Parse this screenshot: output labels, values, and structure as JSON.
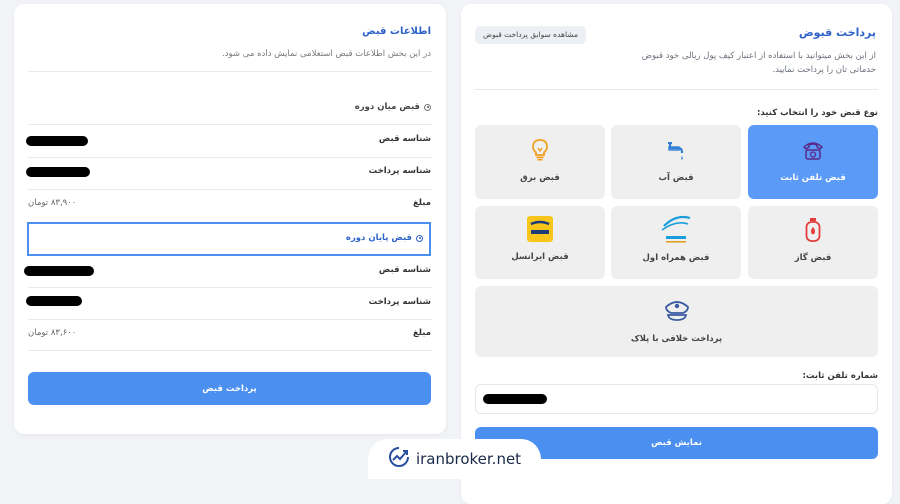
{
  "payment": {
    "title": "پرداخت قبوض",
    "history_button": "مشاهده سوابق پرداخت قبوض",
    "description": "از این بخش میتوانید با استفاده از اعتبار کیف پول ریالی خود قبوض خدماتی تان را پرداخت نمایید.",
    "type_label": "نوع قبض خود را انتخاب کنید:",
    "bill_types": [
      {
        "label": "قبض تلفن ثابت",
        "icon": "landline-phone-icon",
        "active": true
      },
      {
        "label": "قبض آب",
        "icon": "water-tap-icon",
        "active": false
      },
      {
        "label": "قبض برق",
        "icon": "light-bulb-icon",
        "active": false
      },
      {
        "label": "قبض گاز",
        "icon": "gas-cylinder-icon",
        "active": false
      },
      {
        "label": "قبض همراه اول",
        "icon": "hamrah-aval-logo",
        "active": false
      },
      {
        "label": "قبض ایرانسل",
        "icon": "irancell-logo",
        "active": false
      },
      {
        "label": "پرداخت خلافی با پلاک",
        "icon": "police-hat-icon",
        "active": false
      }
    ],
    "phone_label": "شماره تلفن ثابت:",
    "show_button": "نمایش قبض"
  },
  "bill_info": {
    "title": "اطلاعات قبض",
    "description": "در این بخش اطلاعات قبض استعلامی نمایش داده می شود.",
    "periods": [
      {
        "heading": "قبض میان دوره",
        "bill_id_label": "شناسه قبض",
        "payment_id_label": "شناسه پرداخت",
        "amount_label": "مبلغ",
        "amount_value": "۸۳,۹۰۰ تومان",
        "selected": false
      },
      {
        "heading": "قبض پایان دوره",
        "bill_id_label": "شناسه قبض",
        "payment_id_label": "شناسه پرداخت",
        "amount_label": "مبلغ",
        "amount_value": "۸۳,۶۰۰ تومان",
        "selected": true
      }
    ],
    "pay_button": "پرداخت قبض"
  },
  "watermark": {
    "text": "iranbroker.net",
    "icon": "chart-trend-icon"
  },
  "colors": {
    "accent": "#4b90f0",
    "title": "#2f63c8",
    "active_tile": "#5b9bf7"
  }
}
